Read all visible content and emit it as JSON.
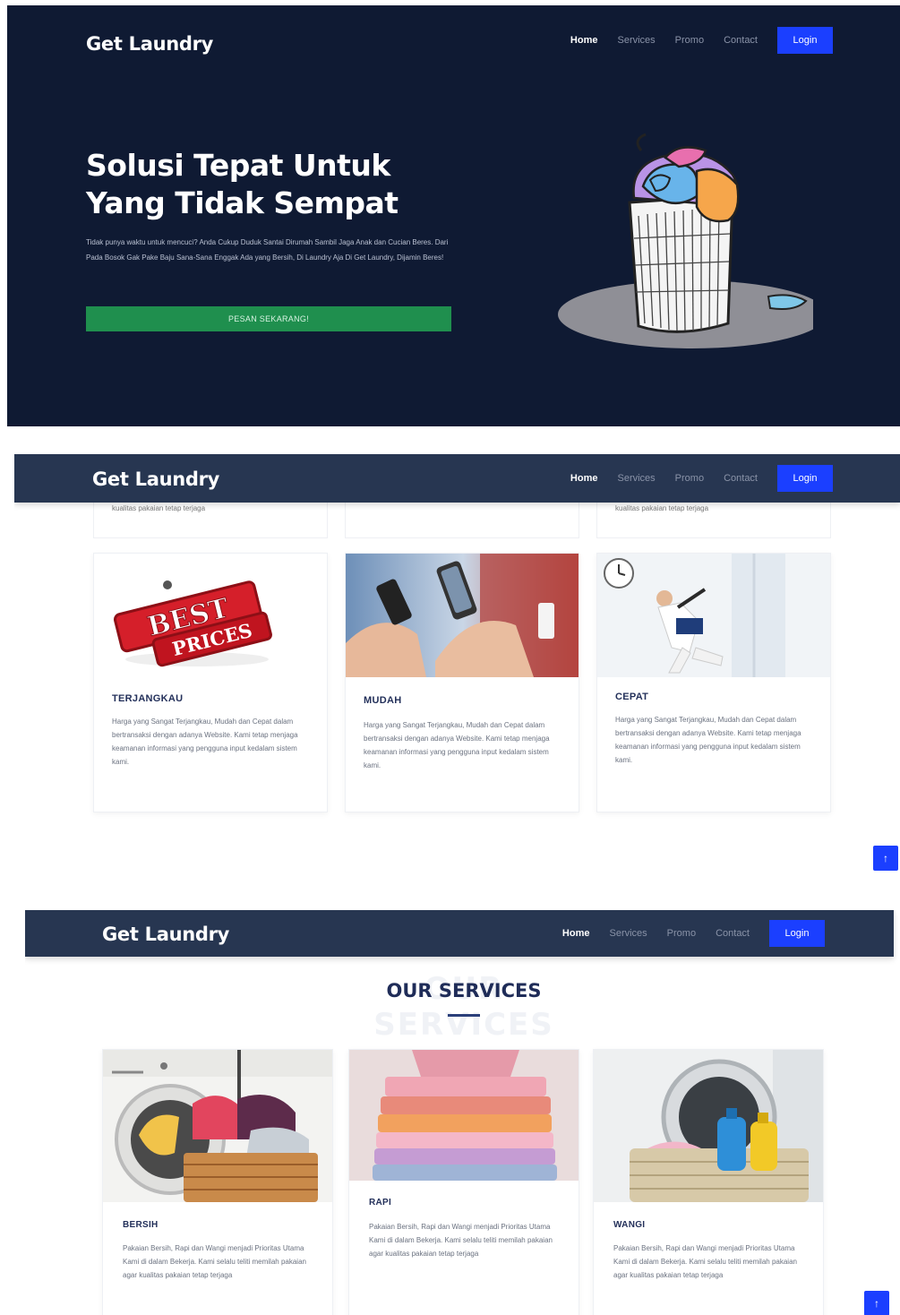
{
  "brand": "Get Laundry",
  "nav": {
    "items": [
      "Home",
      "Services",
      "Promo",
      "Contact"
    ],
    "login": "Login"
  },
  "hero": {
    "title": "Solusi Tepat Untuk Yang Tidak Sempat",
    "description": "Tidak punya waktu untuk mencuci? Anda Cukup Duduk Santai Dirumah Sambil Jaga Anak dan Cucian Beres. Dari Pada Bosok Gak Pake Baju Sana-Sana Enggak Ada yang Bersih, Di Laundry Aja Di Get Laundry, Dijamin Beres!",
    "cta": "PESAN SEKARANG!"
  },
  "features": {
    "prev_text": "kualitas pakaian tetap terjaga",
    "cards": [
      {
        "title": "TERJANGKAU",
        "description": "Harga yang Sangat Terjangkau, Mudah dan Cepat dalam bertransaksi dengan adanya Website. Kami tetap menjaga keamanan informasi yang pengguna input kedalam sistem kami.",
        "image": "best-prices-sticker"
      },
      {
        "title": "MUDAH",
        "description": "Harga yang Sangat Terjangkau, Mudah dan Cepat dalam bertransaksi dengan adanya Website. Kami tetap menjaga keamanan informasi yang pengguna input kedalam sistem kami.",
        "image": "hands-holding-phones"
      },
      {
        "title": "CEPAT",
        "description": "Harga yang Sangat Terjangkau, Mudah dan Cepat dalam bertransaksi dengan adanya Website. Kami tetap menjaga keamanan informasi yang pengguna input kedalam sistem kami.",
        "image": "running-businessman"
      }
    ]
  },
  "services": {
    "heading": "OUR SERVICES",
    "heading_bg": "OUR SERVICES",
    "cards": [
      {
        "title": "BERSIH",
        "description": "Pakaian Bersih, Rapi dan Wangi menjadi Prioritas Utama Kami di dalam Bekerja. Kami selalu teliti memilah pakaian agar kualitas pakaian tetap terjaga",
        "image": "washing-machine-basket"
      },
      {
        "title": "RAPI",
        "description": "Pakaian Bersih, Rapi dan Wangi menjadi Prioritas Utama Kami di dalam Bekerja. Kami selalu teliti memilah pakaian agar kualitas pakaian tetap terjaga",
        "image": "folded-shirts"
      },
      {
        "title": "WANGI",
        "description": "Pakaian Bersih, Rapi dan Wangi menjadi Prioritas Utama Kami di dalam Bekerja. Kami selalu teliti memilah pakaian agar kualitas pakaian tetap terjaga",
        "image": "detergent-bottles"
      }
    ]
  },
  "back_to_top_icon": "arrow-up-icon",
  "colors": {
    "hero_bg": "#0f1a33",
    "nav_bg": "#273651",
    "accent": "#1b3fff",
    "cta": "#1f8f4e"
  }
}
